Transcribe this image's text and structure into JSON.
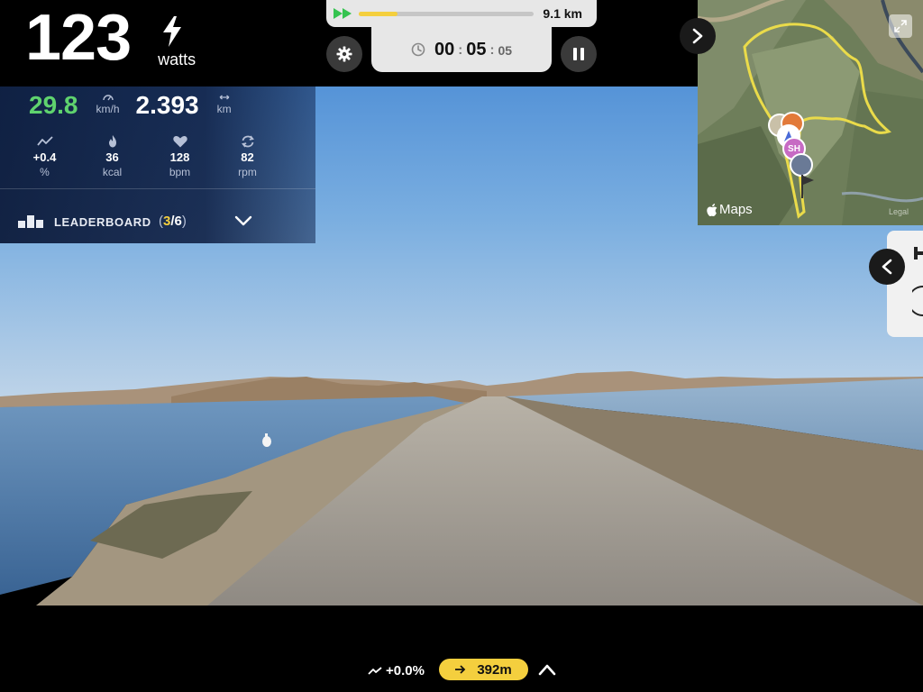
{
  "power": {
    "value": "123",
    "unit": "watts"
  },
  "route": {
    "distance": "9.1 km",
    "progress": 0.22
  },
  "timer": {
    "hours": "00",
    "minutes": "05",
    "seconds": "05"
  },
  "stats": {
    "speed": {
      "value": "29.8",
      "unit": "km/h"
    },
    "distance": {
      "value": "2.393",
      "unit": "km"
    },
    "metrics": [
      {
        "icon": "grade-icon",
        "value": "+0.4",
        "unit": "%"
      },
      {
        "icon": "flame-icon",
        "value": "36",
        "unit": "kcal"
      },
      {
        "icon": "heart-icon",
        "value": "128",
        "unit": "bpm"
      },
      {
        "icon": "cadence-icon",
        "value": "82",
        "unit": "rpm"
      }
    ]
  },
  "leaderboard": {
    "label": "LEADERBOARD",
    "open_paren": "(",
    "rank": "3",
    "slash_total": "/6",
    "close_paren": ")"
  },
  "map": {
    "logo_text": "Maps",
    "legal": "Legal",
    "avatar_initials": "SH"
  },
  "footer": {
    "grade_ahead": "+0.0%",
    "next_distance": "392m"
  },
  "colors": {
    "accent_yellow": "#f4cf3e",
    "speed_green": "#5fd36e",
    "panel_navy": "#0e1e42"
  }
}
